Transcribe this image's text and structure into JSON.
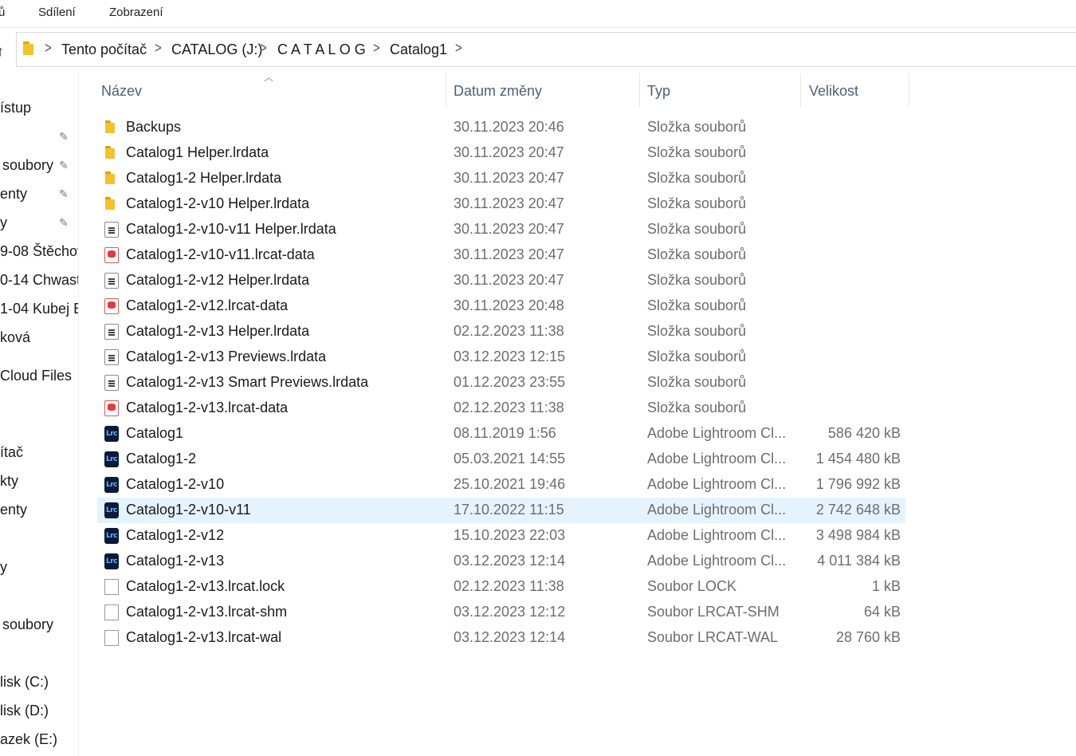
{
  "ribbon": {
    "tabs": [
      "ů",
      "Sdílení",
      "Zobrazení"
    ]
  },
  "address": {
    "crumbs": [
      "Tento počítač",
      "CATALOG (J:)",
      "C A T A L O G",
      "Catalog1"
    ]
  },
  "nav": {
    "items": [
      "ístup",
      "soubory",
      "enty",
      "y",
      "9-08 Štěchov",
      "0-14 Chwast",
      "1-04 Kubej E",
      "ková",
      "Cloud Files",
      "ítač",
      "kty",
      "enty",
      "y",
      "soubory",
      "lisk (C:)",
      "lisk (D:)",
      "azek (E:)"
    ]
  },
  "columns": {
    "name": "Název",
    "date": "Datum změny",
    "type": "Typ",
    "size": "Velikost"
  },
  "files": [
    {
      "icon": "folder-icon",
      "name": "Backups",
      "date": "30.11.2023 20:46",
      "type": "Složka souborů",
      "size": ""
    },
    {
      "icon": "folder-icon",
      "name": "Catalog1 Helper.lrdata",
      "date": "30.11.2023 20:47",
      "type": "Složka souborů",
      "size": ""
    },
    {
      "icon": "folder-icon",
      "name": "Catalog1-2 Helper.lrdata",
      "date": "30.11.2023 20:47",
      "type": "Složka souborů",
      "size": ""
    },
    {
      "icon": "folder-icon",
      "name": "Catalog1-2-v10 Helper.lrdata",
      "date": "30.11.2023 20:47",
      "type": "Složka souborů",
      "size": ""
    },
    {
      "icon": "document-icon",
      "name": "Catalog1-2-v10-v11 Helper.lrdata",
      "date": "30.11.2023 20:47",
      "type": "Složka souborů",
      "size": ""
    },
    {
      "icon": "data-file-icon",
      "name": "Catalog1-2-v10-v11.lrcat-data",
      "date": "30.11.2023 20:47",
      "type": "Složka souborů",
      "size": ""
    },
    {
      "icon": "document-icon",
      "name": "Catalog1-2-v12 Helper.lrdata",
      "date": "30.11.2023 20:47",
      "type": "Složka souborů",
      "size": ""
    },
    {
      "icon": "data-file-icon",
      "name": "Catalog1-2-v12.lrcat-data",
      "date": "30.11.2023 20:48",
      "type": "Složka souborů",
      "size": ""
    },
    {
      "icon": "document-icon",
      "name": "Catalog1-2-v13 Helper.lrdata",
      "date": "02.12.2023 11:38",
      "type": "Složka souborů",
      "size": ""
    },
    {
      "icon": "document-icon",
      "name": "Catalog1-2-v13 Previews.lrdata",
      "date": "03.12.2023 12:15",
      "type": "Složka souborů",
      "size": ""
    },
    {
      "icon": "document-icon",
      "name": "Catalog1-2-v13 Smart Previews.lrdata",
      "date": "01.12.2023 23:55",
      "type": "Složka souborů",
      "size": ""
    },
    {
      "icon": "data-file-icon",
      "name": "Catalog1-2-v13.lrcat-data",
      "date": "02.12.2023 11:38",
      "type": "Složka souborů",
      "size": ""
    },
    {
      "icon": "lightroom-icon",
      "name": "Catalog1",
      "date": "08.11.2019 1:56",
      "type": "Adobe Lightroom Cl...",
      "size": "586 420 kB"
    },
    {
      "icon": "lightroom-icon",
      "name": "Catalog1-2",
      "date": "05.03.2021 14:55",
      "type": "Adobe Lightroom Cl...",
      "size": "1 454 480 kB"
    },
    {
      "icon": "lightroom-icon",
      "name": "Catalog1-2-v10",
      "date": "25.10.2021 19:46",
      "type": "Adobe Lightroom Cl...",
      "size": "1 796 992 kB"
    },
    {
      "icon": "lightroom-icon",
      "name": "Catalog1-2-v10-v11",
      "date": "17.10.2022 11:15",
      "type": "Adobe Lightroom Cl...",
      "size": "2 742 648 kB",
      "selected": true
    },
    {
      "icon": "lightroom-icon",
      "name": "Catalog1-2-v12",
      "date": "15.10.2023 22:03",
      "type": "Adobe Lightroom Cl...",
      "size": "3 498 984 kB"
    },
    {
      "icon": "lightroom-icon",
      "name": "Catalog1-2-v13",
      "date": "03.12.2023 12:14",
      "type": "Adobe Lightroom Cl...",
      "size": "4 011 384 kB"
    },
    {
      "icon": "blank-file-icon",
      "name": "Catalog1-2-v13.lrcat.lock",
      "date": "02.12.2023 11:38",
      "type": "Soubor LOCK",
      "size": "1 kB"
    },
    {
      "icon": "blank-file-icon",
      "name": "Catalog1-2-v13.lrcat-shm",
      "date": "03.12.2023 12:12",
      "type": "Soubor LRCAT-SHM",
      "size": "64 kB"
    },
    {
      "icon": "blank-file-icon",
      "name": "Catalog1-2-v13.lrcat-wal",
      "date": "03.12.2023 12:14",
      "type": "Soubor LRCAT-WAL",
      "size": "28 760 kB"
    }
  ]
}
